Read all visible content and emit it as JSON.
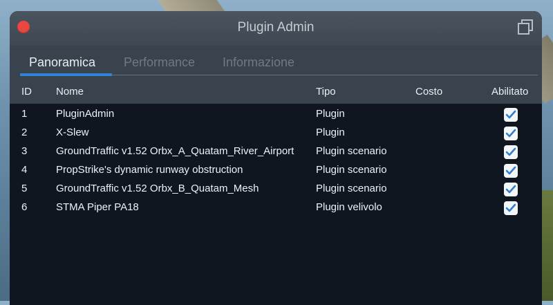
{
  "window": {
    "title": "Plugin Admin"
  },
  "tabs": [
    {
      "label": "Panoramica",
      "active": true
    },
    {
      "label": "Performance",
      "active": false
    },
    {
      "label": "Informazione",
      "active": false
    }
  ],
  "table": {
    "columns": {
      "id": "ID",
      "name": "Nome",
      "type": "Tipo",
      "cost": "Costo",
      "enabled": "Abilitato"
    },
    "rows": [
      {
        "id": "1",
        "name": "PluginAdmin",
        "type": "Plugin",
        "cost": "",
        "enabled": true
      },
      {
        "id": "2",
        "name": "X-Slew",
        "type": "Plugin",
        "cost": "",
        "enabled": true
      },
      {
        "id": "3",
        "name": "GroundTraffic v1.52 Orbx_A_Quatam_River_Airport",
        "type": "Plugin scenario",
        "cost": "",
        "enabled": true
      },
      {
        "id": "4",
        "name": "PropStrike's dynamic runway obstruction",
        "type": "Plugin scenario",
        "cost": "",
        "enabled": true
      },
      {
        "id": "5",
        "name": "GroundTraffic v1.52 Orbx_B_Quatam_Mesh",
        "type": "Plugin scenario",
        "cost": "",
        "enabled": true
      },
      {
        "id": "6",
        "name": "STMA Piper PA18",
        "type": "Plugin velivolo",
        "cost": "",
        "enabled": true
      }
    ]
  },
  "colors": {
    "accent": "#2f86d9",
    "close": "#e9473f",
    "check": "#2f7fd0"
  },
  "icons": {
    "close": "close-icon",
    "popout": "popout-window-icon",
    "checkbox": "checkmark-icon"
  }
}
